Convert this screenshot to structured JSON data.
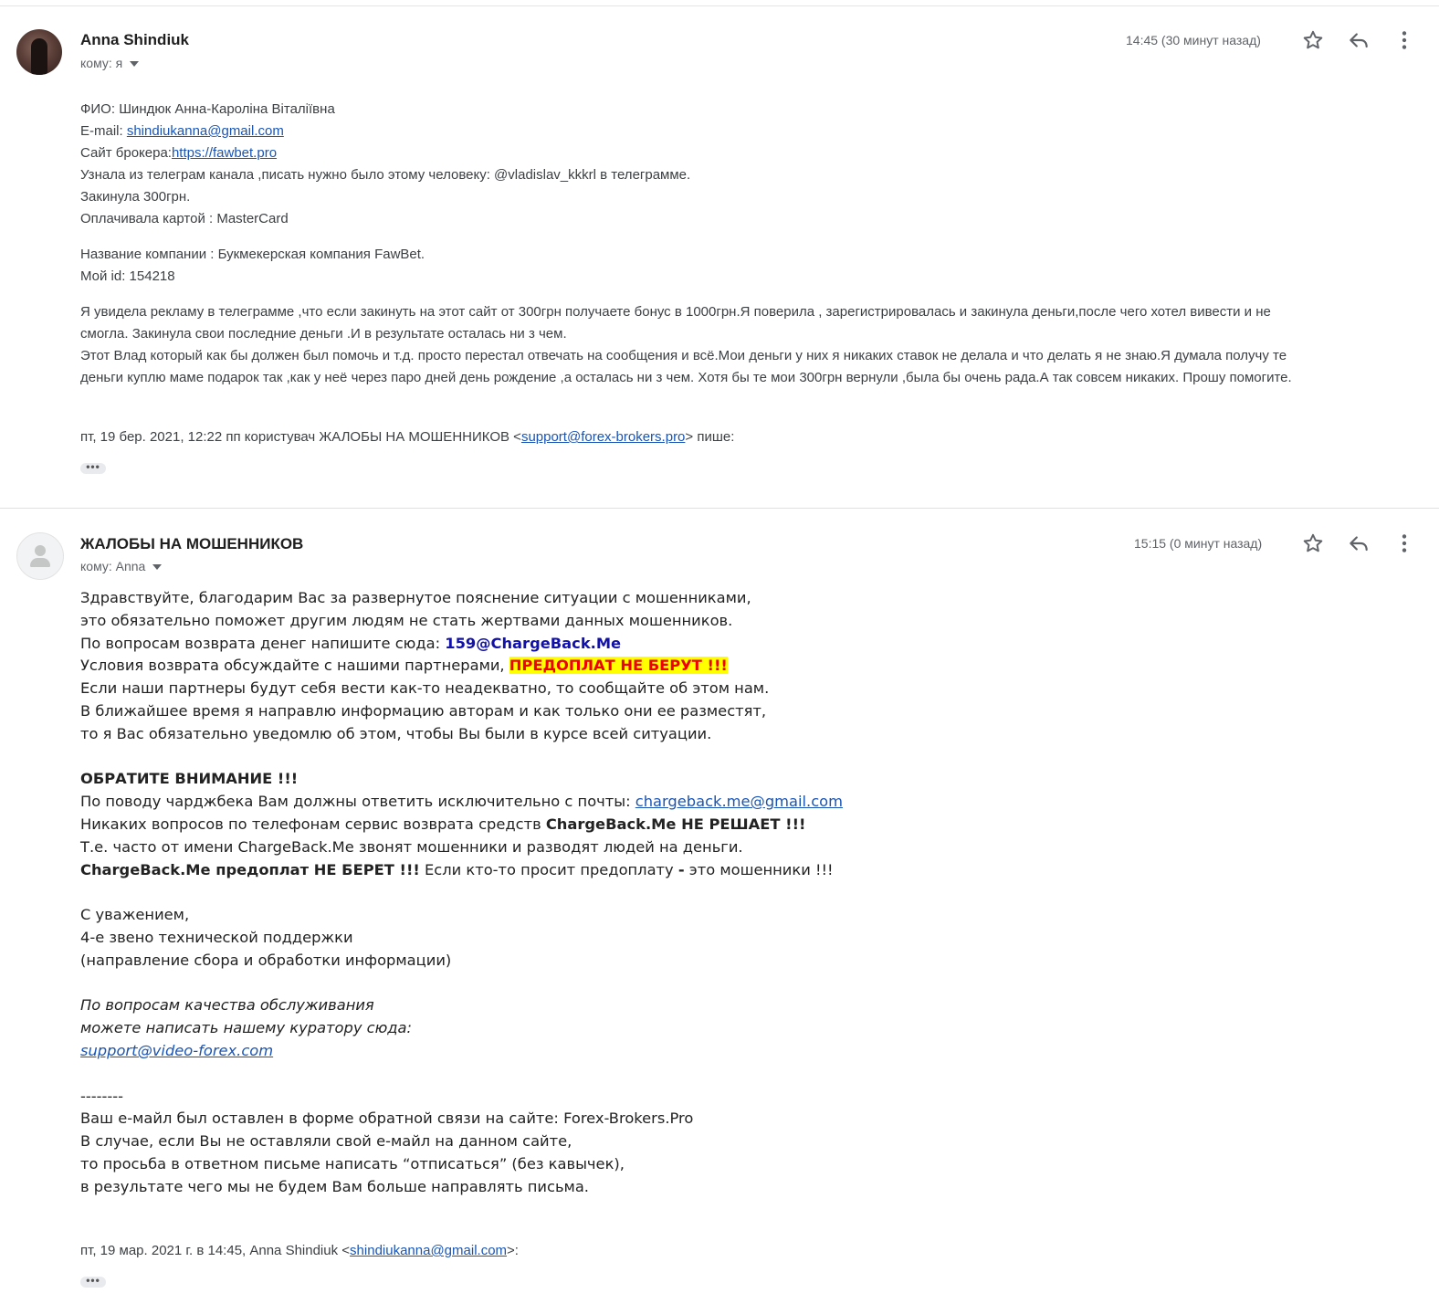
{
  "message1": {
    "sender": "Anna Shindiuk",
    "to": "кому: я",
    "time": "14:45 (30 минут назад)",
    "lines": {
      "fio": "ФИО: Шиндюк Анна-Кароліна Віталіївна",
      "email_label": "E-mail: ",
      "email": "shindiukanna@gmail.com",
      "site_label": "Сайт брокера:",
      "site": "https://fawbet.pro",
      "source": "Узнала из телеграм канала ,писать нужно было этому человеку: @vladislav_kkkrl в телеграмме.",
      "amount": "Закинула 300грн.",
      "payment": "Оплачивала картой : MasterCard",
      "company": "Название компании : Букмекерская компания FawBet.",
      "id": "Мой id: 154218",
      "story_1": "Я увидела рекламу в телеграмме ,что если закинуть на этот сайт от 300грн получаете бонус в 1000грн.Я поверила , зарегистрировалась и закинула деньги,после чего хотел вивести и не",
      "story_2": "смогла. Закинула свои последние деньги .И в результате осталась ни з чем.",
      "story_3": "Этот Влад который как бы должен был помочь и т.д. просто перестал отвечать на сообщения и всё.Мои деньги у них я никаких ставок не делала и что делать я не знаю.Я думала получу те",
      "story_4": "деньги куплю маме подарок так ,как у неё через паро дней день рождение ,а осталась ни з чем. Хотя бы те мои 300грн вернули ,была бы очень рада.А так совсем никаких. Прошу помогите."
    },
    "quote_prefix": "пт, 19 бер. 2021, 12:22 пп користувач ЖАЛОБЫ НА МОШЕННИКОВ <",
    "quote_email": "support@forex-brokers.pro",
    "quote_suffix": "> пише:",
    "dots": "•••"
  },
  "message2": {
    "sender": "ЖАЛОБЫ НА МОШЕННИКОВ",
    "to": "кому: Anna",
    "time": "15:15 (0 минут назад)",
    "p1": "Здравствуйте, благодарим Вас за развернутое пояснение ситуации с мошенниками,",
    "p2": "это обязательно поможет другим людям не стать жертвами данных мошенников.",
    "p3": "По вопросам возврата денег напишите сюда: ",
    "p3_email": "159@ChargeBack.Me",
    "p4": "Условия возврата обсуждайте с нашими партнерами, ",
    "p4_highlight": "ПРЕДОПЛАТ НЕ БЕРУТ !!!",
    "p5": "Если наши партнеры будут себя вести как-то неадекватно, то сообщайте об этом нам.",
    "p6": "В ближайшее время я направлю информацию авторам и как только они ее разместят,",
    "p7": "то я Вас обязательно уведомлю об этом, чтобы Вы были в курсе всей ситуации.",
    "attention": "ОБРАТИТЕ ВНИМАНИЕ !!!",
    "a1": "По поводу чарджбека Вам должны ответить исключительно с почты: ",
    "a1_email": "chargeback.me@gmail.com",
    "a2": "Никаких вопросов по телефонам сервис возврата средств ",
    "a2_bold": "ChargeBack.Me НЕ РЕШАЕТ !!!",
    "a3": "Т.е. часто от имени ChargeBack.Me звонят мошенники и разводят людей на деньги.",
    "a4_bold": "ChargeBack.Me предоплат НЕ БЕРЕТ !!!",
    "a4": " Если кто-то просит предоплату ",
    "a4_dash": "-",
    "a4_end": " это мошенники !!!",
    "s1": "С уважением,",
    "s2": "4-е звено технической поддержки",
    "s3": "(направление сбора и обработки информации)",
    "q1": "По вопросам качества обслуживания",
    "q2": "можете написать нашему куратору сюда:",
    "q3": "support@video-forex.com",
    "divider": "--------",
    "f1": "Ваш е-майл был оставлен в форме обратной связи на сайте: Forex-Brokers.Pro",
    "f2": "В случае, если Вы не оставляли свой е-майл на данном сайте,",
    "f3": "то просьба в ответном письме написать “отписаться” (без кавычек),",
    "f4": "в результате чего мы не будем Вам больше направлять письма.",
    "quote_prefix": "пт, 19 мар. 2021 г. в 14:45, Anna Shindiuk <",
    "quote_email": "shindiukanna@gmail.com",
    "quote_suffix": ">:",
    "dots": "•••"
  },
  "icons": {
    "star": "star-icon",
    "reply": "reply-icon",
    "more": "more-vert-icon"
  }
}
